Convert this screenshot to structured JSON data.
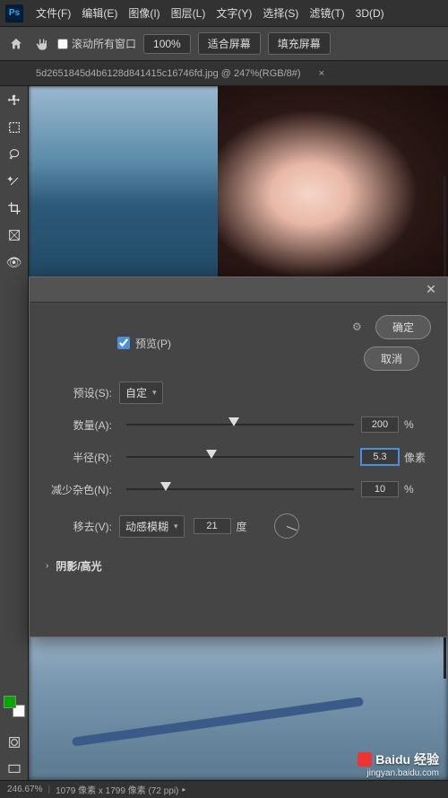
{
  "menubar": {
    "items": [
      "文件(F)",
      "编辑(E)",
      "图像(I)",
      "图层(L)",
      "文字(Y)",
      "选择(S)",
      "滤镜(T)",
      "3D(D)"
    ]
  },
  "optionsbar": {
    "scroll_all": "滚动所有窗口",
    "zoom": "100%",
    "fit_screen": "适合屏幕",
    "fill_screen": "填充屏幕"
  },
  "tab": {
    "title": "5d2651845d4b6128d841415c16746fd.jpg @ 247%(RGB/8#)",
    "close": "×"
  },
  "dialog": {
    "preview_label": "预览(P)",
    "preset_label": "预设(S):",
    "preset_value": "自定",
    "ok": "确定",
    "cancel": "取消",
    "rows": {
      "amount": {
        "label": "数量(A):",
        "value": "200",
        "unit": "%",
        "pos": 45
      },
      "radius": {
        "label": "半径(R):",
        "value": "5.3",
        "unit": "像素",
        "pos": 35
      },
      "noise": {
        "label": "减少杂色(N):",
        "value": "10",
        "unit": "%",
        "pos": 15
      }
    },
    "remove": {
      "label": "移去(V):",
      "type": "动感模糊",
      "angle_value": "21",
      "angle_unit": "度"
    },
    "section2": "阴影/高光"
  },
  "statusbar": {
    "zoom": "246.67%",
    "dims": "1079 像素 x 1799 像素 (72 ppi)"
  },
  "watermark": {
    "brand": "Baidu 经验",
    "url": "jingyan.baidu.com"
  }
}
